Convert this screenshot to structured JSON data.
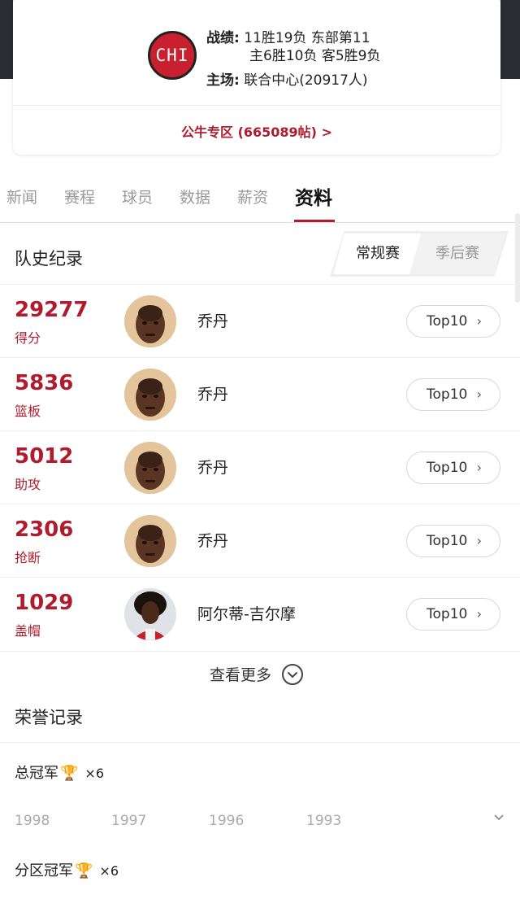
{
  "team": {
    "logo_text": "CHI",
    "record_label": "战绩:",
    "record_line1": "11胜19负 东部第11",
    "record_line2": "主6胜10负 客5胜9负",
    "arena_label": "主场:",
    "arena_value": "联合中心(20917人)",
    "forum_link": "公牛专区 (665089帖) >"
  },
  "tabs": [
    {
      "label": "新闻"
    },
    {
      "label": "赛程"
    },
    {
      "label": "球员"
    },
    {
      "label": "数据"
    },
    {
      "label": "薪资"
    },
    {
      "label": "资料",
      "active": true
    }
  ],
  "history": {
    "title": "队史纪录",
    "toggle": {
      "active": "常规赛",
      "inactive": "季后赛"
    },
    "records": [
      {
        "value": "29277",
        "label": "得分",
        "player": "乔丹",
        "button": "Top10"
      },
      {
        "value": "5836",
        "label": "篮板",
        "player": "乔丹",
        "button": "Top10"
      },
      {
        "value": "5012",
        "label": "助攻",
        "player": "乔丹",
        "button": "Top10"
      },
      {
        "value": "2306",
        "label": "抢断",
        "player": "乔丹",
        "button": "Top10"
      },
      {
        "value": "1029",
        "label": "盖帽",
        "player": "阿尔蒂-吉尔摩",
        "button": "Top10"
      }
    ],
    "more": "查看更多"
  },
  "honors": {
    "title": "荣誉记录",
    "championships": {
      "label": "总冠军",
      "times": "×6"
    },
    "years": [
      "1998",
      "1997",
      "1996",
      "1993"
    ],
    "division": {
      "label": "分区冠军",
      "times": "×6"
    }
  },
  "colors": {
    "accent": "#b01c2e",
    "logo": "#c8202f",
    "top_band": "#2a2d33",
    "trophy": "#e0a81a"
  }
}
